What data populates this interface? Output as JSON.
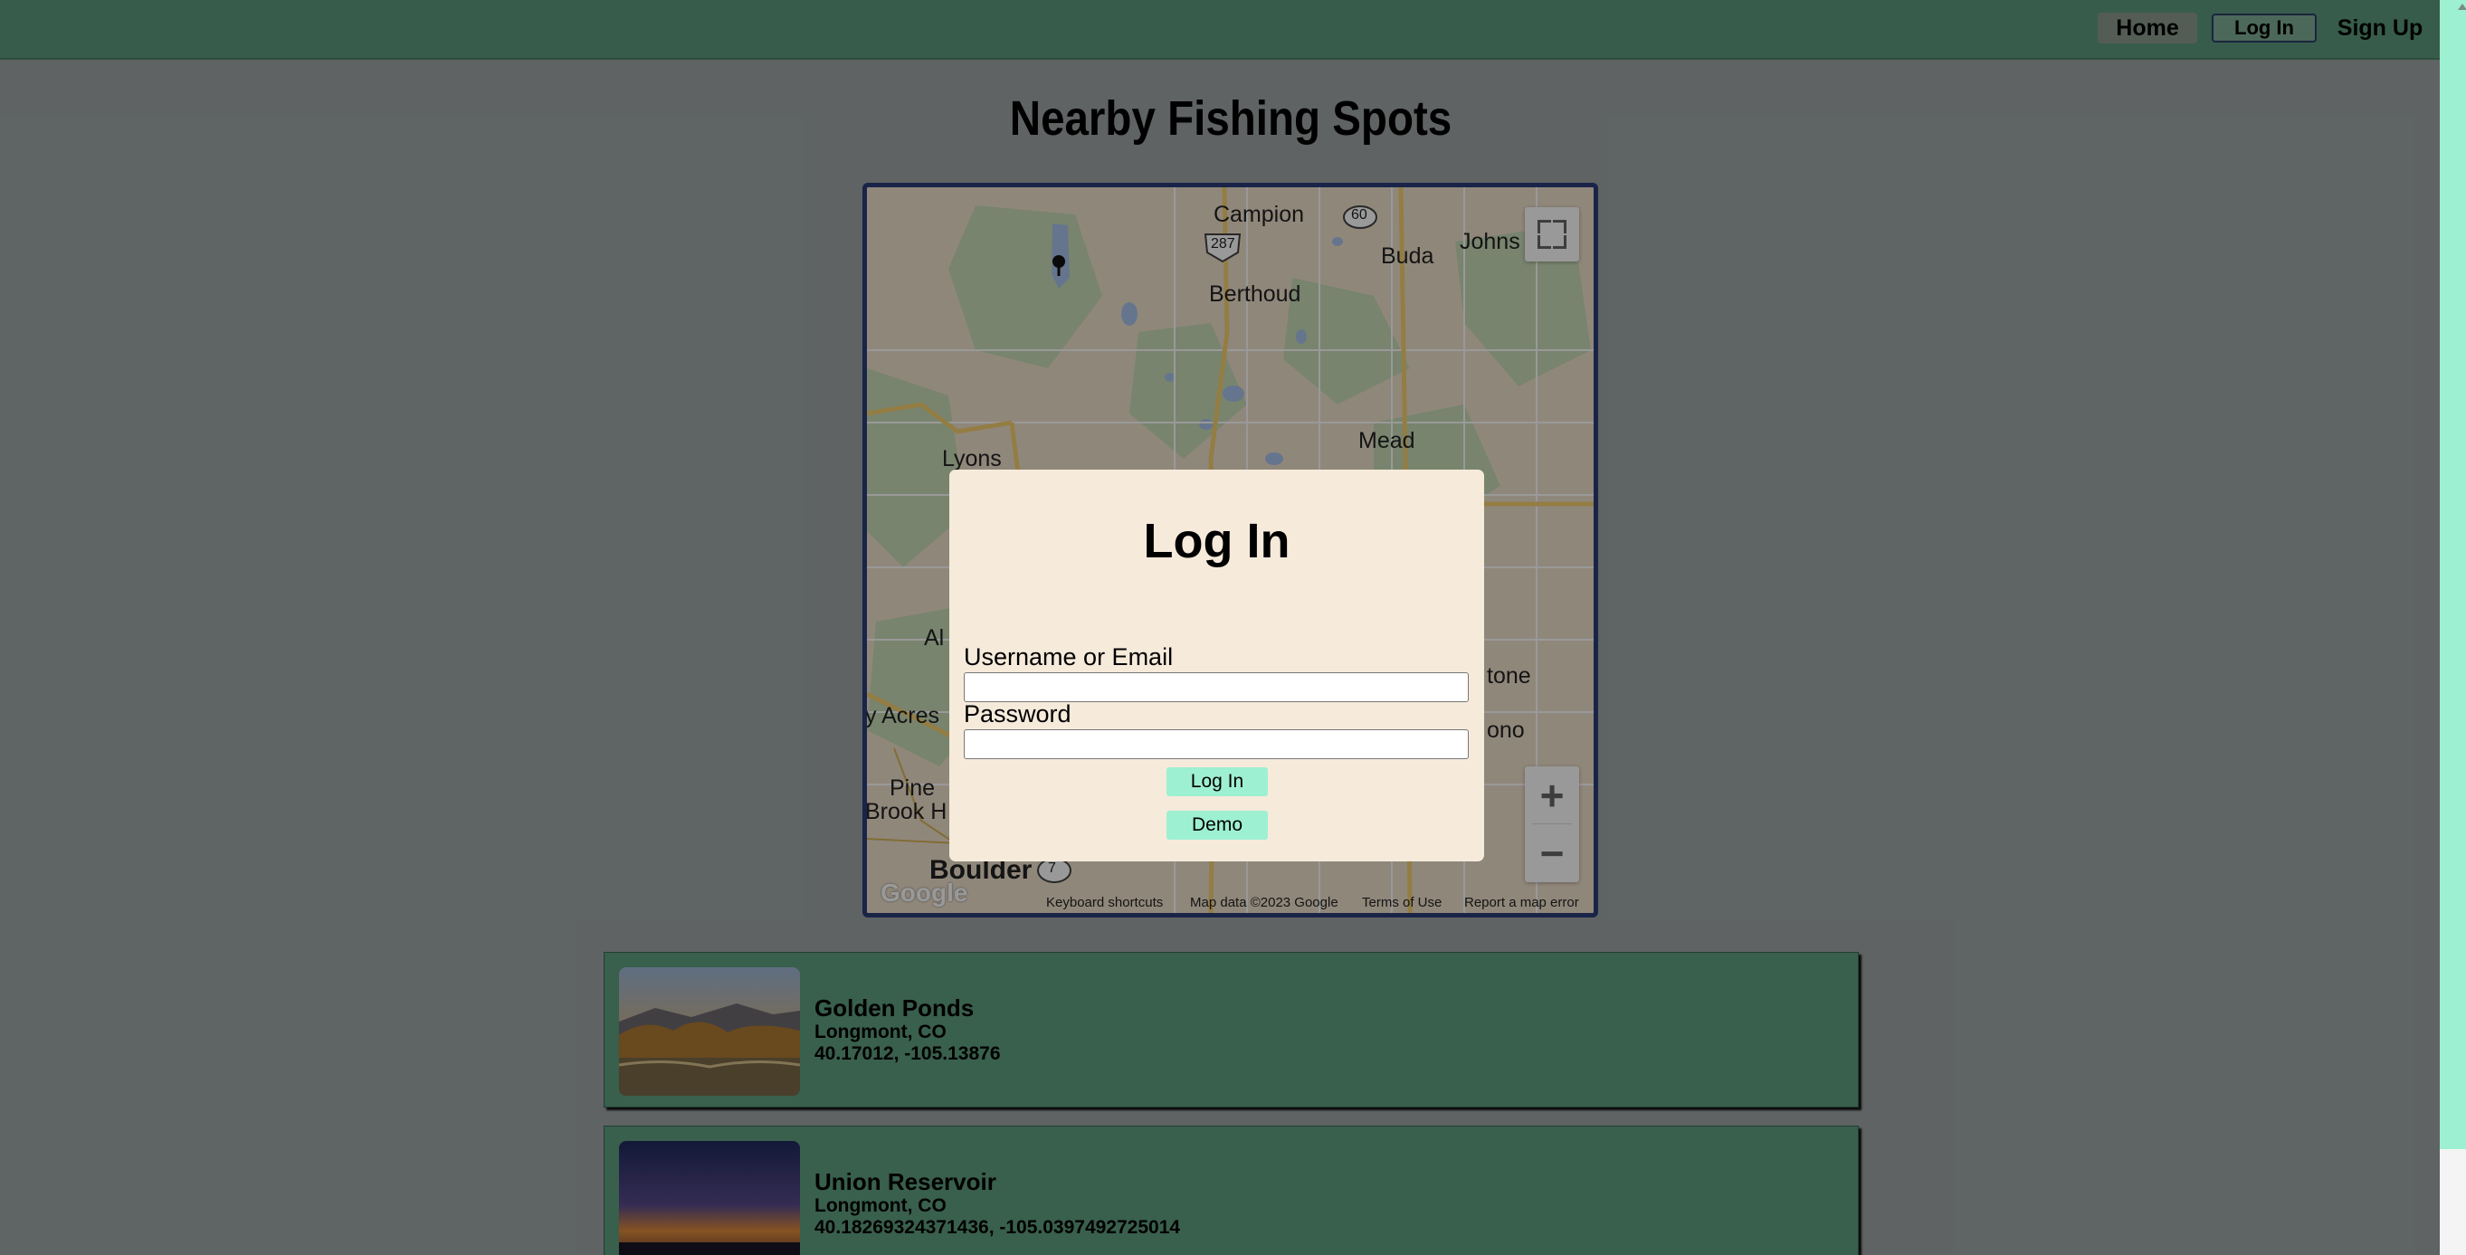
{
  "nav": {
    "home": "Home",
    "login": "Log In",
    "signup": "Sign Up"
  },
  "page_title": "Nearby Fishing Spots",
  "map": {
    "labels": {
      "campion": "Campion",
      "berthoud": "Berthoud",
      "buda": "Buda",
      "johns": "Johns",
      "mead": "Mead",
      "lyons": "Lyons",
      "al": "Al",
      "acres": "y Acres",
      "stone": "tone",
      "ono": "ono",
      "pine": "Pine",
      "brook": "Brook H",
      "boulder": "Boulder"
    },
    "shields": {
      "us287": "287",
      "sh60": "60",
      "sh7": "7"
    },
    "zoom_in": "+",
    "zoom_out": "−",
    "footer": {
      "shortcuts": "Keyboard shortcuts",
      "data": "Map data ©2023 Google",
      "terms": "Terms of Use",
      "report": "Report a map error"
    },
    "logo": "Google",
    "colors": {
      "land": "#f0e1cd",
      "green": "#c8dcb8",
      "water": "#a8c4ec",
      "road": "#f5d171"
    }
  },
  "spots": [
    {
      "name": "Golden Ponds",
      "location": "Longmont, CO",
      "coords": "40.17012, -105.13876"
    },
    {
      "name": "Union Reservoir",
      "location": "Longmont, CO",
      "coords": "40.18269324371436, -105.0397492725014"
    }
  ],
  "modal": {
    "title": "Log In",
    "username_label": "Username or Email",
    "username_value": "",
    "password_label": "Password",
    "password_value": "",
    "login_button": "Log In",
    "demo_button": "Demo"
  },
  "colors": {
    "navbar": "#5d9a7e",
    "accent": "#9ef0d2",
    "modal_bg": "#f6eadb",
    "card": "#5f9e80"
  }
}
